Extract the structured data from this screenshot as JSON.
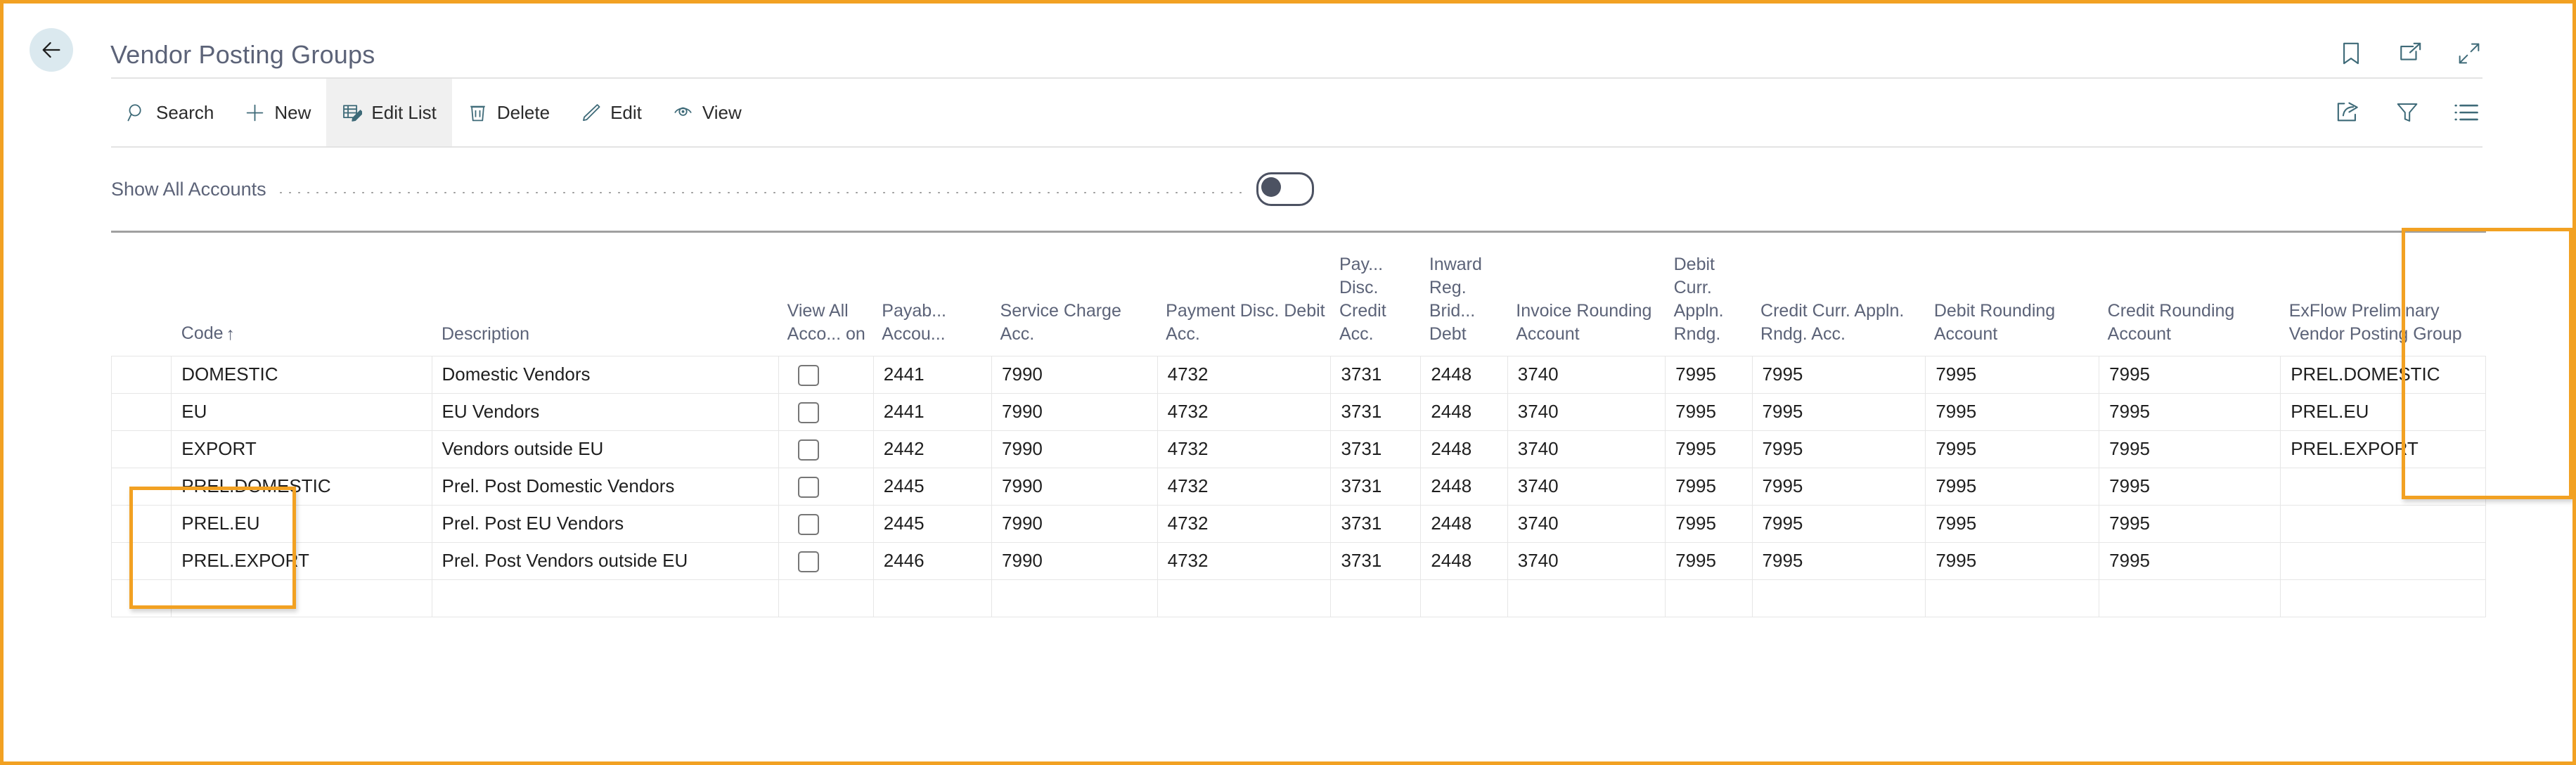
{
  "header": {
    "title": "Vendor Posting Groups",
    "back_icon": "back-arrow-icon",
    "icons": [
      {
        "name": "bookmark-icon",
        "label": "Bookmark"
      },
      {
        "name": "open-in-new-window-icon",
        "label": "Open in new window"
      },
      {
        "name": "collapse-icon",
        "label": "Minimize"
      }
    ]
  },
  "toolbar": {
    "items": [
      {
        "icon": "search-icon",
        "label": "Search",
        "active": false
      },
      {
        "icon": "plus-icon",
        "label": "New",
        "active": false
      },
      {
        "icon": "edit-list-icon",
        "label": "Edit List",
        "active": true
      },
      {
        "icon": "trash-icon",
        "label": "Delete",
        "active": false
      },
      {
        "icon": "pencil-icon",
        "label": "Edit",
        "active": false
      },
      {
        "icon": "eye-icon",
        "label": "View",
        "active": false
      }
    ],
    "right_icons": [
      {
        "name": "share-icon",
        "label": "Share"
      },
      {
        "name": "filter-icon",
        "label": "Filter"
      },
      {
        "name": "list-options-icon",
        "label": "Options"
      }
    ]
  },
  "filter": {
    "show_all_accounts_label": "Show All Accounts",
    "show_all_accounts_value": "off"
  },
  "table": {
    "columns": [
      {
        "key": "selector",
        "label": "",
        "type": "selector"
      },
      {
        "key": "code",
        "label": "Code",
        "sorted": "ascending",
        "sort_glyph": "↑"
      },
      {
        "key": "description",
        "label": "Description"
      },
      {
        "key": "view_all_accounts_on",
        "label": "View All Acco... on",
        "type": "checkbox"
      },
      {
        "key": "payables_account",
        "label": "Payab... Accou..."
      },
      {
        "key": "service_charge_acc",
        "label": "Service Charge Acc."
      },
      {
        "key": "payment_disc_debit_acc",
        "label": "Payment Disc. Debit Acc."
      },
      {
        "key": "payment_disc_credit_acc",
        "label": "Pay... Disc. Credit Acc."
      },
      {
        "key": "inward_reg_bridge_debt",
        "label": "Inward Reg. Brid... Debt"
      },
      {
        "key": "invoice_rounding_account",
        "label": "Invoice Rounding Account"
      },
      {
        "key": "debit_curr_appln_rndg",
        "label": "Debit Curr. Appln. Rndg."
      },
      {
        "key": "credit_curr_appln_rndg_acc",
        "label": "Credit Curr. Appln. Rndg. Acc."
      },
      {
        "key": "debit_rounding_account",
        "label": "Debit Rounding Account"
      },
      {
        "key": "credit_rounding_account",
        "label": "Credit Rounding Account"
      },
      {
        "key": "exflow_prel_vendor_posting_group",
        "label": "ExFlow Preliminary Vendor Posting Group",
        "highlighted": true
      }
    ],
    "rows": [
      {
        "code": "DOMESTIC",
        "description": "Domestic Vendors",
        "view_all_accounts_on": false,
        "payables_account": "2441",
        "service_charge_acc": "7990",
        "payment_disc_debit_acc": "4732",
        "payment_disc_credit_acc": "3731",
        "inward_reg_bridge_debt": "2448",
        "invoice_rounding_account": "3740",
        "debit_curr_appln_rndg": "7995",
        "credit_curr_appln_rndg_acc": "7995",
        "debit_rounding_account": "7995",
        "credit_rounding_account": "7995",
        "exflow_prel_vendor_posting_group": "PREL.DOMESTIC"
      },
      {
        "code": "EU",
        "description": "EU Vendors",
        "view_all_accounts_on": false,
        "payables_account": "2441",
        "service_charge_acc": "7990",
        "payment_disc_debit_acc": "4732",
        "payment_disc_credit_acc": "3731",
        "inward_reg_bridge_debt": "2448",
        "invoice_rounding_account": "3740",
        "debit_curr_appln_rndg": "7995",
        "credit_curr_appln_rndg_acc": "7995",
        "debit_rounding_account": "7995",
        "credit_rounding_account": "7995",
        "exflow_prel_vendor_posting_group": "PREL.EU"
      },
      {
        "code": "EXPORT",
        "description": "Vendors outside EU",
        "view_all_accounts_on": false,
        "payables_account": "2442",
        "service_charge_acc": "7990",
        "payment_disc_debit_acc": "4732",
        "payment_disc_credit_acc": "3731",
        "inward_reg_bridge_debt": "2448",
        "invoice_rounding_account": "3740",
        "debit_curr_appln_rndg": "7995",
        "credit_curr_appln_rndg_acc": "7995",
        "debit_rounding_account": "7995",
        "credit_rounding_account": "7995",
        "exflow_prel_vendor_posting_group": "PREL.EXPORT"
      },
      {
        "code": "PREL.DOMESTIC",
        "description": "Prel. Post Domestic Vendors",
        "view_all_accounts_on": false,
        "payables_account": "2445",
        "service_charge_acc": "7990",
        "payment_disc_debit_acc": "4732",
        "payment_disc_credit_acc": "3731",
        "inward_reg_bridge_debt": "2448",
        "invoice_rounding_account": "3740",
        "debit_curr_appln_rndg": "7995",
        "credit_curr_appln_rndg_acc": "7995",
        "debit_rounding_account": "7995",
        "credit_rounding_account": "7995",
        "exflow_prel_vendor_posting_group": ""
      },
      {
        "code": "PREL.EU",
        "description": "Prel. Post EU Vendors",
        "view_all_accounts_on": false,
        "payables_account": "2445",
        "service_charge_acc": "7990",
        "payment_disc_debit_acc": "4732",
        "payment_disc_credit_acc": "3731",
        "inward_reg_bridge_debt": "2448",
        "invoice_rounding_account": "3740",
        "debit_curr_appln_rndg": "7995",
        "credit_curr_appln_rndg_acc": "7995",
        "debit_rounding_account": "7995",
        "credit_rounding_account": "7995",
        "exflow_prel_vendor_posting_group": ""
      },
      {
        "code": "PREL.EXPORT",
        "description": "Prel. Post Vendors outside EU",
        "view_all_accounts_on": false,
        "payables_account": "2446",
        "service_charge_acc": "7990",
        "payment_disc_debit_acc": "4732",
        "payment_disc_credit_acc": "3731",
        "inward_reg_bridge_debt": "2448",
        "invoice_rounding_account": "3740",
        "debit_curr_appln_rndg": "7995",
        "credit_curr_appln_rndg_acc": "7995",
        "debit_rounding_account": "7995",
        "credit_rounding_account": "7995",
        "exflow_prel_vendor_posting_group": ""
      },
      {
        "code": "",
        "description": "",
        "view_all_accounts_on": null,
        "payables_account": "",
        "service_charge_acc": "",
        "payment_disc_debit_acc": "",
        "payment_disc_credit_acc": "",
        "inward_reg_bridge_debt": "",
        "invoice_rounding_account": "",
        "debit_curr_appln_rndg": "",
        "credit_curr_appln_rndg_acc": "",
        "debit_rounding_account": "",
        "credit_rounding_account": "",
        "exflow_prel_vendor_posting_group": ""
      }
    ]
  },
  "annotations": {
    "highlight_color": "#F2A122",
    "boxes": [
      {
        "name": "code-column-highlight",
        "target": "code column rows PREL.DOMESTIC / PREL.EU / PREL.EXPORT"
      },
      {
        "name": "exflow-column-highlight",
        "target": "ExFlow Preliminary Vendor Posting Group column"
      }
    ]
  }
}
